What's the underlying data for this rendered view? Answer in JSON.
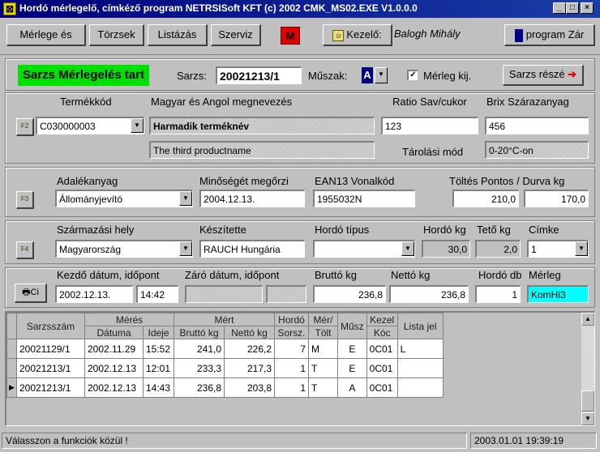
{
  "window": {
    "title": "Hordó mérlegelő, címkéző program  NETRSISoft KFT (c) 2002  CMK_MS02.EXE  V1.0.0.0",
    "min_label": "_",
    "max_label": "□",
    "close_label": "×"
  },
  "toolbar": {
    "merlege_label": "Mérlege és",
    "torzsek_label": "Törzsek",
    "listazas_label": "Listázás",
    "szerviz_label": "Szerviz",
    "m_label": "M",
    "kezelo_label": "Kezelő:",
    "operator_name": "Balogh Mihály",
    "program_zar_label": "program Zár"
  },
  "batch": {
    "status": "Sarzs Mérlegelés tart",
    "sarzs_label": "Sarzs:",
    "sarzs_value": "20021213/1",
    "muszak_label": "Műszak:",
    "muszak_value": "A",
    "merleg_kij_label": "Mérleg kij.",
    "sarzs_resz_label": "Sarzs részé"
  },
  "product": {
    "fkey": "F2",
    "code_label": "Termékkód",
    "code_value": "C030000003",
    "name_label": "Magyar és Angol megnevezés",
    "hu_name": "Harmadik terméknév",
    "en_name": "The third productname",
    "ratio_label": "Ratio Sav/cukor",
    "ratio_value": "123",
    "brix_label": "Brix Szárazanyag",
    "brix_value": "456",
    "tarolasi_label": "Tárolási mód",
    "tarolasi_value": "0-20°C-on"
  },
  "additive": {
    "fkey": "F3",
    "adalek_label": "Adalékanyag",
    "adalek_value": "Állományjevító",
    "min_label": "Minőségét megőrzi",
    "min_value": "2004.12.13.",
    "ean_label": "EAN13 Vonalkód",
    "ean_value": "1955032N",
    "toltes_label": "Töltés Pontos / Durva kg",
    "toltes_pontos": "210,0",
    "toltes_durva": "170,0"
  },
  "origin": {
    "fkey": "F4",
    "szarm_label": "Származási hely",
    "szarm_value": "Magyarország",
    "keszitette_label": "Készítette",
    "keszitette_value": "RAUCH Hungária",
    "hordo_tipus_label": "Hordó típus",
    "hordo_tipus_value": "",
    "hordo_kg_label": "Hordó kg",
    "hordo_kg_value": "30,0",
    "teto_kg_label": "Tető kg",
    "teto_kg_value": "2,0",
    "cimke_label": "Címke",
    "cimke_value": "1"
  },
  "weigh": {
    "print_label": "Ci",
    "kezdo_label": "Kezdő dátum, időpont",
    "kezdo_date": "2002.12.13.",
    "kezdo_time": "14:42",
    "zaro_label": "Záró dátum, időpont",
    "brutto_label": "Bruttó kg",
    "brutto_value": "236,8",
    "netto_label": "Nettó kg",
    "netto_value": "236,8",
    "hordo_db_label": "Hordó db",
    "hordo_db_value": "1",
    "merleg_label": "Mérleg",
    "merleg_value": "KomHi3"
  },
  "table": {
    "h_sarzsszam": "Sarzsszám",
    "h_meres": "Mérés",
    "h_datuma": "Dátuma",
    "h_ideje": "Ideje",
    "h_mert": "Mért",
    "h_brutto": "Bruttó kg",
    "h_netto": "Nettó kg",
    "h_hordo": "Hordó",
    "h_sorsz": "Sorsz.",
    "h_mer": "Mér/",
    "h_tolt": "Tölt",
    "h_musz": "Műsz",
    "h_kezel": "Kezel",
    "h_koc": "Kóc",
    "h_listajel": "Lista jel",
    "rows": [
      {
        "sarzs": "20021129/1",
        "datum": "2002.11.29",
        "ido": "15:52",
        "brutto": "241,0",
        "netto": "226,2",
        "sorsz": "7",
        "mer": "M",
        "musz": "E",
        "kezel": "0C01",
        "lista": "L"
      },
      {
        "sarzs": "20021213/1",
        "datum": "2002.12.13",
        "ido": "12:01",
        "brutto": "233,3",
        "netto": "217,3",
        "sorsz": "1",
        "mer": "T",
        "musz": "E",
        "kezel": "0C01",
        "lista": ""
      },
      {
        "sarzs": "20021213/1",
        "datum": "2002.12.13",
        "ido": "14:43",
        "brutto": "236,8",
        "netto": "203,8",
        "sorsz": "1",
        "mer": "T",
        "musz": "A",
        "kezel": "0C01",
        "lista": ""
      }
    ]
  },
  "status": {
    "message": "Válasszon a funkciók közül !",
    "datetime": "2003.01.01 19:39:19"
  },
  "colors": {
    "status_green": "#00e000",
    "m_red": "#e00000",
    "merleg_cyan": "#00ffff",
    "muszak_blue": "#000080"
  }
}
